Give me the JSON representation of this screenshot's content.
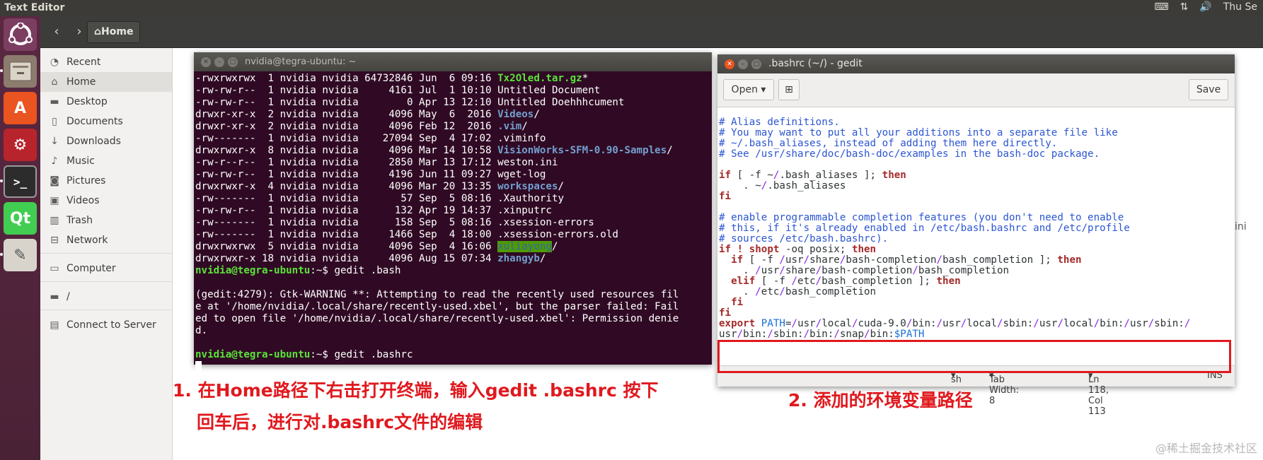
{
  "top_panel": {
    "title": "Text Editor",
    "clock": "Thu Se"
  },
  "file_manager": {
    "path_button": "Home",
    "sidebar": [
      {
        "label": "Recent",
        "icon": "clock-icon"
      },
      {
        "label": "Home",
        "icon": "home-icon",
        "active": true
      },
      {
        "label": "Desktop",
        "icon": "folder-icon"
      },
      {
        "label": "Documents",
        "icon": "document-icon"
      },
      {
        "label": "Downloads",
        "icon": "download-icon"
      },
      {
        "label": "Music",
        "icon": "music-icon"
      },
      {
        "label": "Pictures",
        "icon": "camera-icon"
      },
      {
        "label": "Videos",
        "icon": "film-icon"
      },
      {
        "label": "Trash",
        "icon": "trash-icon"
      },
      {
        "label": "Network",
        "icon": "network-icon"
      },
      {
        "label": "Computer",
        "icon": "drive-icon"
      },
      {
        "label": "/",
        "icon": "folder-icon"
      },
      {
        "label": "Connect to Server",
        "icon": "server-icon"
      }
    ]
  },
  "terminal": {
    "title": "nvidia@tegra-ubuntu: ~",
    "listing": [
      {
        "meta": "-rwxrwxrwx  1 nvidia nvidia 64732846 Jun  6 09:16 ",
        "name": "Tx2Oled.tar.gz",
        "suffix": "*",
        "style": "exe"
      },
      {
        "meta": "-rw-rw-r--  1 nvidia nvidia     4161 Jul  1 10:10 ",
        "name": "Untitled Document",
        "suffix": "",
        "style": "plain"
      },
      {
        "meta": "-rw-rw-r--  1 nvidia nvidia        0 Apr 13 12:10 ",
        "name": "Untitled Doehhhcument",
        "suffix": "",
        "style": "plain"
      },
      {
        "meta": "drwxr-xr-x  2 nvidia nvidia     4096 May  6  2016 ",
        "name": "Videos",
        "suffix": "/",
        "style": "dir"
      },
      {
        "meta": "drwxr-xr-x  2 nvidia nvidia     4096 Feb 12  2016 ",
        "name": ".vim",
        "suffix": "/",
        "style": "dir"
      },
      {
        "meta": "-rw-------  1 nvidia nvidia    27094 Sep  4 17:02 ",
        "name": ".viminfo",
        "suffix": "",
        "style": "plain"
      },
      {
        "meta": "drwxrwxr-x  8 nvidia nvidia     4096 Mar 14 10:58 ",
        "name": "VisionWorks-SFM-0.90-Samples",
        "suffix": "/",
        "style": "dir"
      },
      {
        "meta": "-rw-r--r--  1 nvidia nvidia     2850 Mar 13 17:12 ",
        "name": "weston.ini",
        "suffix": "",
        "style": "plain"
      },
      {
        "meta": "-rw-rw-r--  1 nvidia nvidia     4196 Jun 11 09:27 ",
        "name": "wget-log",
        "suffix": "",
        "style": "plain"
      },
      {
        "meta": "drwxrwxr-x  4 nvidia nvidia     4096 Mar 20 13:35 ",
        "name": "workspaces",
        "suffix": "/",
        "style": "dir"
      },
      {
        "meta": "-rw-------  1 nvidia nvidia       57 Sep  5 08:16 ",
        "name": ".Xauthority",
        "suffix": "",
        "style": "plain"
      },
      {
        "meta": "-rw-rw-r--  1 nvidia nvidia      132 Apr 19 14:37 ",
        "name": ".xinputrc",
        "suffix": "",
        "style": "plain"
      },
      {
        "meta": "-rw-------  1 nvidia nvidia      158 Sep  5 08:16 ",
        "name": ".xsession-errors",
        "suffix": "",
        "style": "plain"
      },
      {
        "meta": "-rw-------  1 nvidia nvidia     1466 Sep  4 18:00 ",
        "name": ".xsession-errors.old",
        "suffix": "",
        "style": "plain"
      },
      {
        "meta": "drwxrwxrwx  5 nvidia nvidia     4096 Sep  4 16:06 ",
        "name": "xuliayong",
        "suffix": "/",
        "style": "shared"
      },
      {
        "meta": "drwxrwxr-x 18 nvidia nvidia     4096 Aug 15 07:34 ",
        "name": "zhangyb",
        "suffix": "/",
        "style": "dir"
      }
    ],
    "prompt": "nvidia@tegra-ubuntu",
    "prompt_suffix": ":~$ ",
    "cmd1": "gedit .bash",
    "warning": [
      "(gedit:4279): Gtk-WARNING **: Attempting to read the recently used resources fil",
      "e at '/home/nvidia/.local/share/recently-used.xbel', but the parser failed: Fail",
      "ed to open file '/home/nvidia/.local/share/recently-used.xbel': Permission denie",
      "d."
    ],
    "cmd2": "gedit .bashrc"
  },
  "gedit": {
    "title": ".bashrc (~/) - gedit",
    "open_label": "Open",
    "save_label": "Save",
    "lines": [
      [
        {
          "t": "# Alias definitions.",
          "s": "c"
        }
      ],
      [
        {
          "t": "# You may want to put all your additions into a separate file like",
          "s": "c"
        }
      ],
      [
        {
          "t": "# ~/.bash_aliases, instead of adding them here directly.",
          "s": "c"
        }
      ],
      [
        {
          "t": "# See /usr/share/doc/bash-doc/examples in the bash-doc package.",
          "s": "c"
        }
      ],
      [],
      [
        {
          "t": "if",
          "s": "k"
        },
        {
          "t": " [ -f ~",
          "s": ""
        },
        {
          "t": "/",
          "s": "p"
        },
        {
          "t": ".bash_aliases ]; ",
          "s": ""
        },
        {
          "t": "then",
          "s": "k"
        }
      ],
      [
        {
          "t": "    . ~",
          "s": ""
        },
        {
          "t": "/",
          "s": "p"
        },
        {
          "t": ".bash_aliases",
          "s": ""
        }
      ],
      [
        {
          "t": "fi",
          "s": "k"
        }
      ],
      [],
      [
        {
          "t": "# enable programmable completion features (you don't need to enable",
          "s": "c"
        }
      ],
      [
        {
          "t": "# this, if it's already enabled in /etc/bash.bashrc and /etc/profile",
          "s": "c"
        }
      ],
      [
        {
          "t": "# sources /etc/bash.bashrc).",
          "s": "c"
        }
      ],
      [
        {
          "t": "if",
          "s": "k"
        },
        {
          "t": " ! ",
          "s": "k"
        },
        {
          "t": "shopt",
          "s": "k"
        },
        {
          "t": " -oq posix; ",
          "s": ""
        },
        {
          "t": "then",
          "s": "k"
        }
      ],
      [
        {
          "t": "  if",
          "s": "k"
        },
        {
          "t": " [ -f ",
          "s": ""
        },
        {
          "t": "/",
          "s": "p"
        },
        {
          "t": "usr",
          "s": ""
        },
        {
          "t": "/",
          "s": "p"
        },
        {
          "t": "share",
          "s": ""
        },
        {
          "t": "/",
          "s": "p"
        },
        {
          "t": "bash-completion",
          "s": ""
        },
        {
          "t": "/",
          "s": "p"
        },
        {
          "t": "bash_completion ]; ",
          "s": ""
        },
        {
          "t": "then",
          "s": "k"
        }
      ],
      [
        {
          "t": "    . ",
          "s": ""
        },
        {
          "t": "/",
          "s": "p"
        },
        {
          "t": "usr",
          "s": ""
        },
        {
          "t": "/",
          "s": "p"
        },
        {
          "t": "share",
          "s": ""
        },
        {
          "t": "/",
          "s": "p"
        },
        {
          "t": "bash-completion",
          "s": ""
        },
        {
          "t": "/",
          "s": "p"
        },
        {
          "t": "bash_completion",
          "s": ""
        }
      ],
      [
        {
          "t": "  elif",
          "s": "k"
        },
        {
          "t": " [ -f ",
          "s": ""
        },
        {
          "t": "/",
          "s": "p"
        },
        {
          "t": "etc",
          "s": ""
        },
        {
          "t": "/",
          "s": "p"
        },
        {
          "t": "bash_completion ]; ",
          "s": ""
        },
        {
          "t": "then",
          "s": "k"
        }
      ],
      [
        {
          "t": "    . ",
          "s": ""
        },
        {
          "t": "/",
          "s": "p"
        },
        {
          "t": "etc",
          "s": ""
        },
        {
          "t": "/",
          "s": "p"
        },
        {
          "t": "bash_completion",
          "s": ""
        }
      ],
      [
        {
          "t": "  fi",
          "s": "k"
        }
      ],
      [
        {
          "t": "fi",
          "s": "k"
        }
      ],
      [
        {
          "t": "export",
          "s": "k"
        },
        {
          "t": " PATH",
          "s": "v"
        },
        {
          "t": "=",
          "s": ""
        },
        {
          "t": "/",
          "s": "p"
        },
        {
          "t": "usr",
          "s": ""
        },
        {
          "t": "/",
          "s": "p"
        },
        {
          "t": "local",
          "s": ""
        },
        {
          "t": "/",
          "s": "p"
        },
        {
          "t": "cuda-9.0",
          "s": ""
        },
        {
          "t": "/",
          "s": "p"
        },
        {
          "t": "bin:",
          "s": ""
        },
        {
          "t": "/",
          "s": "p"
        },
        {
          "t": "usr",
          "s": ""
        },
        {
          "t": "/",
          "s": "p"
        },
        {
          "t": "local",
          "s": ""
        },
        {
          "t": "/",
          "s": "p"
        },
        {
          "t": "sbin:",
          "s": ""
        },
        {
          "t": "/",
          "s": "p"
        },
        {
          "t": "usr",
          "s": ""
        },
        {
          "t": "/",
          "s": "p"
        },
        {
          "t": "local",
          "s": ""
        },
        {
          "t": "/",
          "s": "p"
        },
        {
          "t": "bin:",
          "s": ""
        },
        {
          "t": "/",
          "s": "p"
        },
        {
          "t": "usr",
          "s": ""
        },
        {
          "t": "/",
          "s": "p"
        },
        {
          "t": "sbin:",
          "s": ""
        },
        {
          "t": "/",
          "s": "p"
        }
      ],
      [
        {
          "t": "usr",
          "s": ""
        },
        {
          "t": "/",
          "s": "p"
        },
        {
          "t": "bin:",
          "s": ""
        },
        {
          "t": "/",
          "s": "p"
        },
        {
          "t": "sbin:",
          "s": ""
        },
        {
          "t": "/",
          "s": "p"
        },
        {
          "t": "bin:",
          "s": ""
        },
        {
          "t": "/",
          "s": "p"
        },
        {
          "t": "snap",
          "s": ""
        },
        {
          "t": "/",
          "s": "p"
        },
        {
          "t": "bin:",
          "s": ""
        },
        {
          "t": "$PATH",
          "s": "v"
        }
      ]
    ],
    "status": {
      "lang": "sh",
      "tab": "Tab Width: 8",
      "pos": "Ln 118, Col 113",
      "mode": "INS"
    }
  },
  "annotations": {
    "step1_line1": "1. 在Home路径下右击打开终端，输入gedit .bashrc 按下",
    "step1_line2": "回车后，进行对.bashrc文件的编辑",
    "step2": "2. 添加的环境变量路径"
  },
  "side_text": "ini",
  "watermark": "@稀土掘金技术社区",
  "colors": {
    "terminal_bg": "#300a24",
    "annotation_red": "#e0191e",
    "launcher_bg": "#5a2841"
  }
}
